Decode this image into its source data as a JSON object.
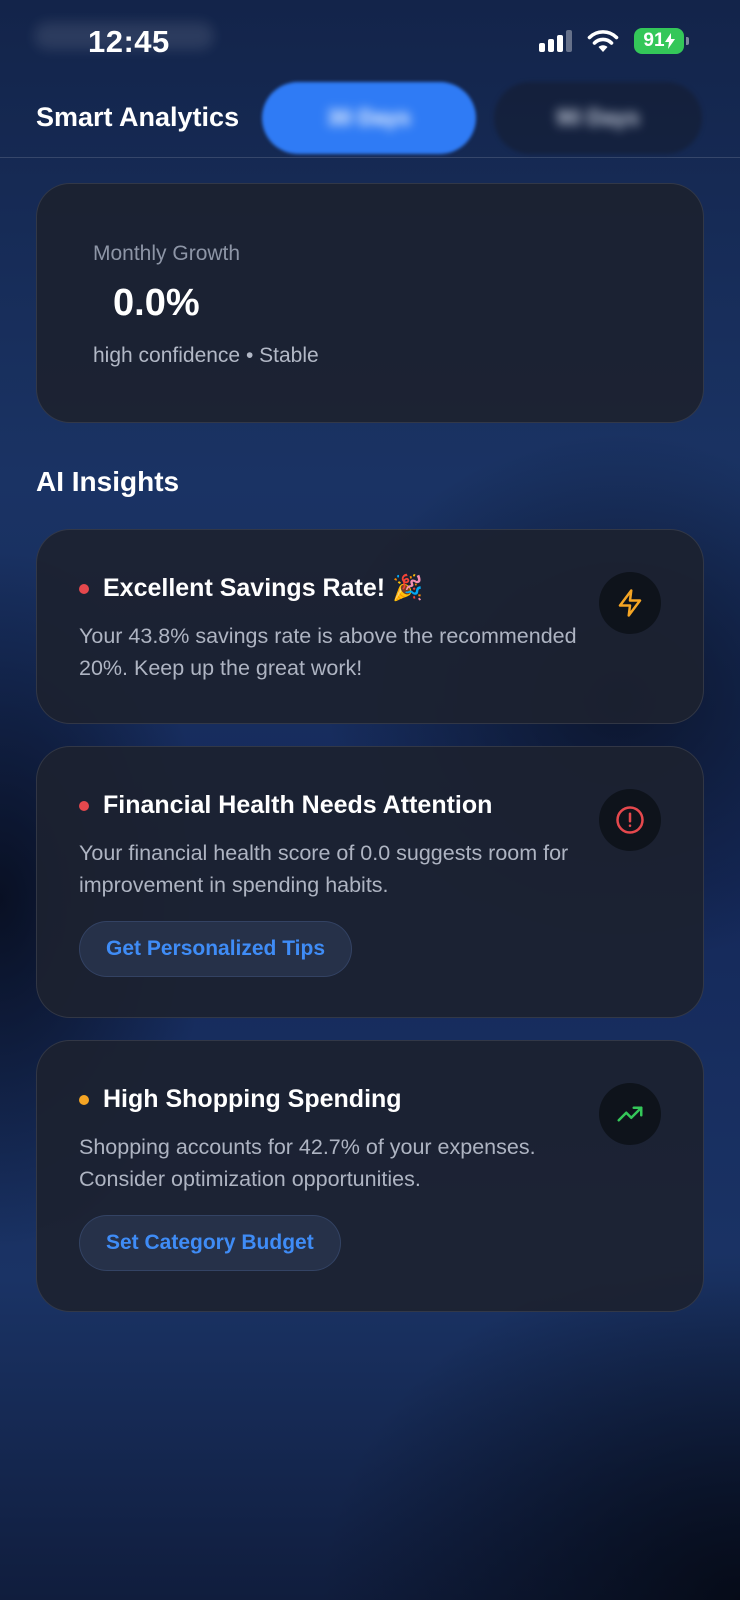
{
  "status_bar": {
    "time": "12:45",
    "battery": "91",
    "icons": [
      "signal-icon",
      "wifi-icon",
      "battery-charging-icon"
    ]
  },
  "header": {
    "title": "Smart Analytics",
    "tabs": [
      {
        "label": "30 Days",
        "active": true
      },
      {
        "label": "90 Days",
        "active": false
      }
    ]
  },
  "growth": {
    "label": "Monthly Growth",
    "value": "0.0%",
    "sub": "high confidence • Stable"
  },
  "insights_section": {
    "title": "AI Insights",
    "items": [
      {
        "title": "Excellent Savings Rate! 🎉",
        "description": "Your 43.8% savings rate is above the recommended 20%. Keep up the great work!",
        "dot_color": "#e5484d",
        "icon": "lightning-icon",
        "icon_color": "#f5a524"
      },
      {
        "title": "Financial Health Needs Attention",
        "description": "Your financial health score of 0.0 suggests room for improvement in spending habits.",
        "dot_color": "#e5484d",
        "icon": "alert-circle-icon",
        "icon_color": "#e5484d",
        "action": "Get Personalized Tips"
      },
      {
        "title": "High Shopping Spending",
        "description": "Shopping accounts for 42.7% of your expenses. Consider optimization opportunities.",
        "dot_color": "#f5a524",
        "icon": "trending-up-icon",
        "icon_color": "#34c759",
        "action": "Set Category Budget"
      }
    ]
  },
  "colors": {
    "accent": "#2f7bf5",
    "card_bg": "#1c2230",
    "link": "#3f8cf6"
  }
}
